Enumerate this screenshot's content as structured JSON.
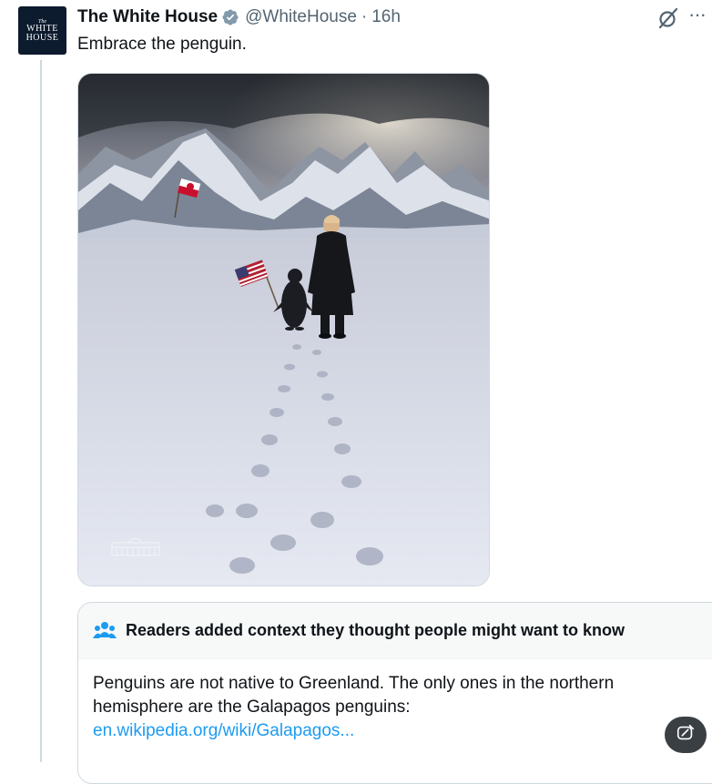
{
  "author": {
    "name": "The White House",
    "handle": "@WhiteHouse",
    "separator": "·",
    "time": "16h",
    "avatar_lines": [
      "The",
      "WHITE",
      "HOUSE"
    ]
  },
  "tweet": {
    "text": "Embrace the penguin."
  },
  "media": {
    "alt_icon": "photo-of-figure-and-penguin-walking-on-snow"
  },
  "community_note": {
    "title": "Readers added context they thought people might want to know",
    "body": "Penguins are not native to Greenland. The only ones in the northern hemisphere are the Galapagos penguins:",
    "link": "en.wikipedia.org/wiki/Galapagos..."
  },
  "icons": {
    "verified": "verified-badge-icon",
    "grok": "grok-icon",
    "more": "more-icon",
    "note": "people-icon",
    "fab": "grok-compose-icon"
  },
  "colors": {
    "accent": "#1d9bf0",
    "text": "#0f1419",
    "muted": "#536471",
    "border": "#cfd9de"
  }
}
